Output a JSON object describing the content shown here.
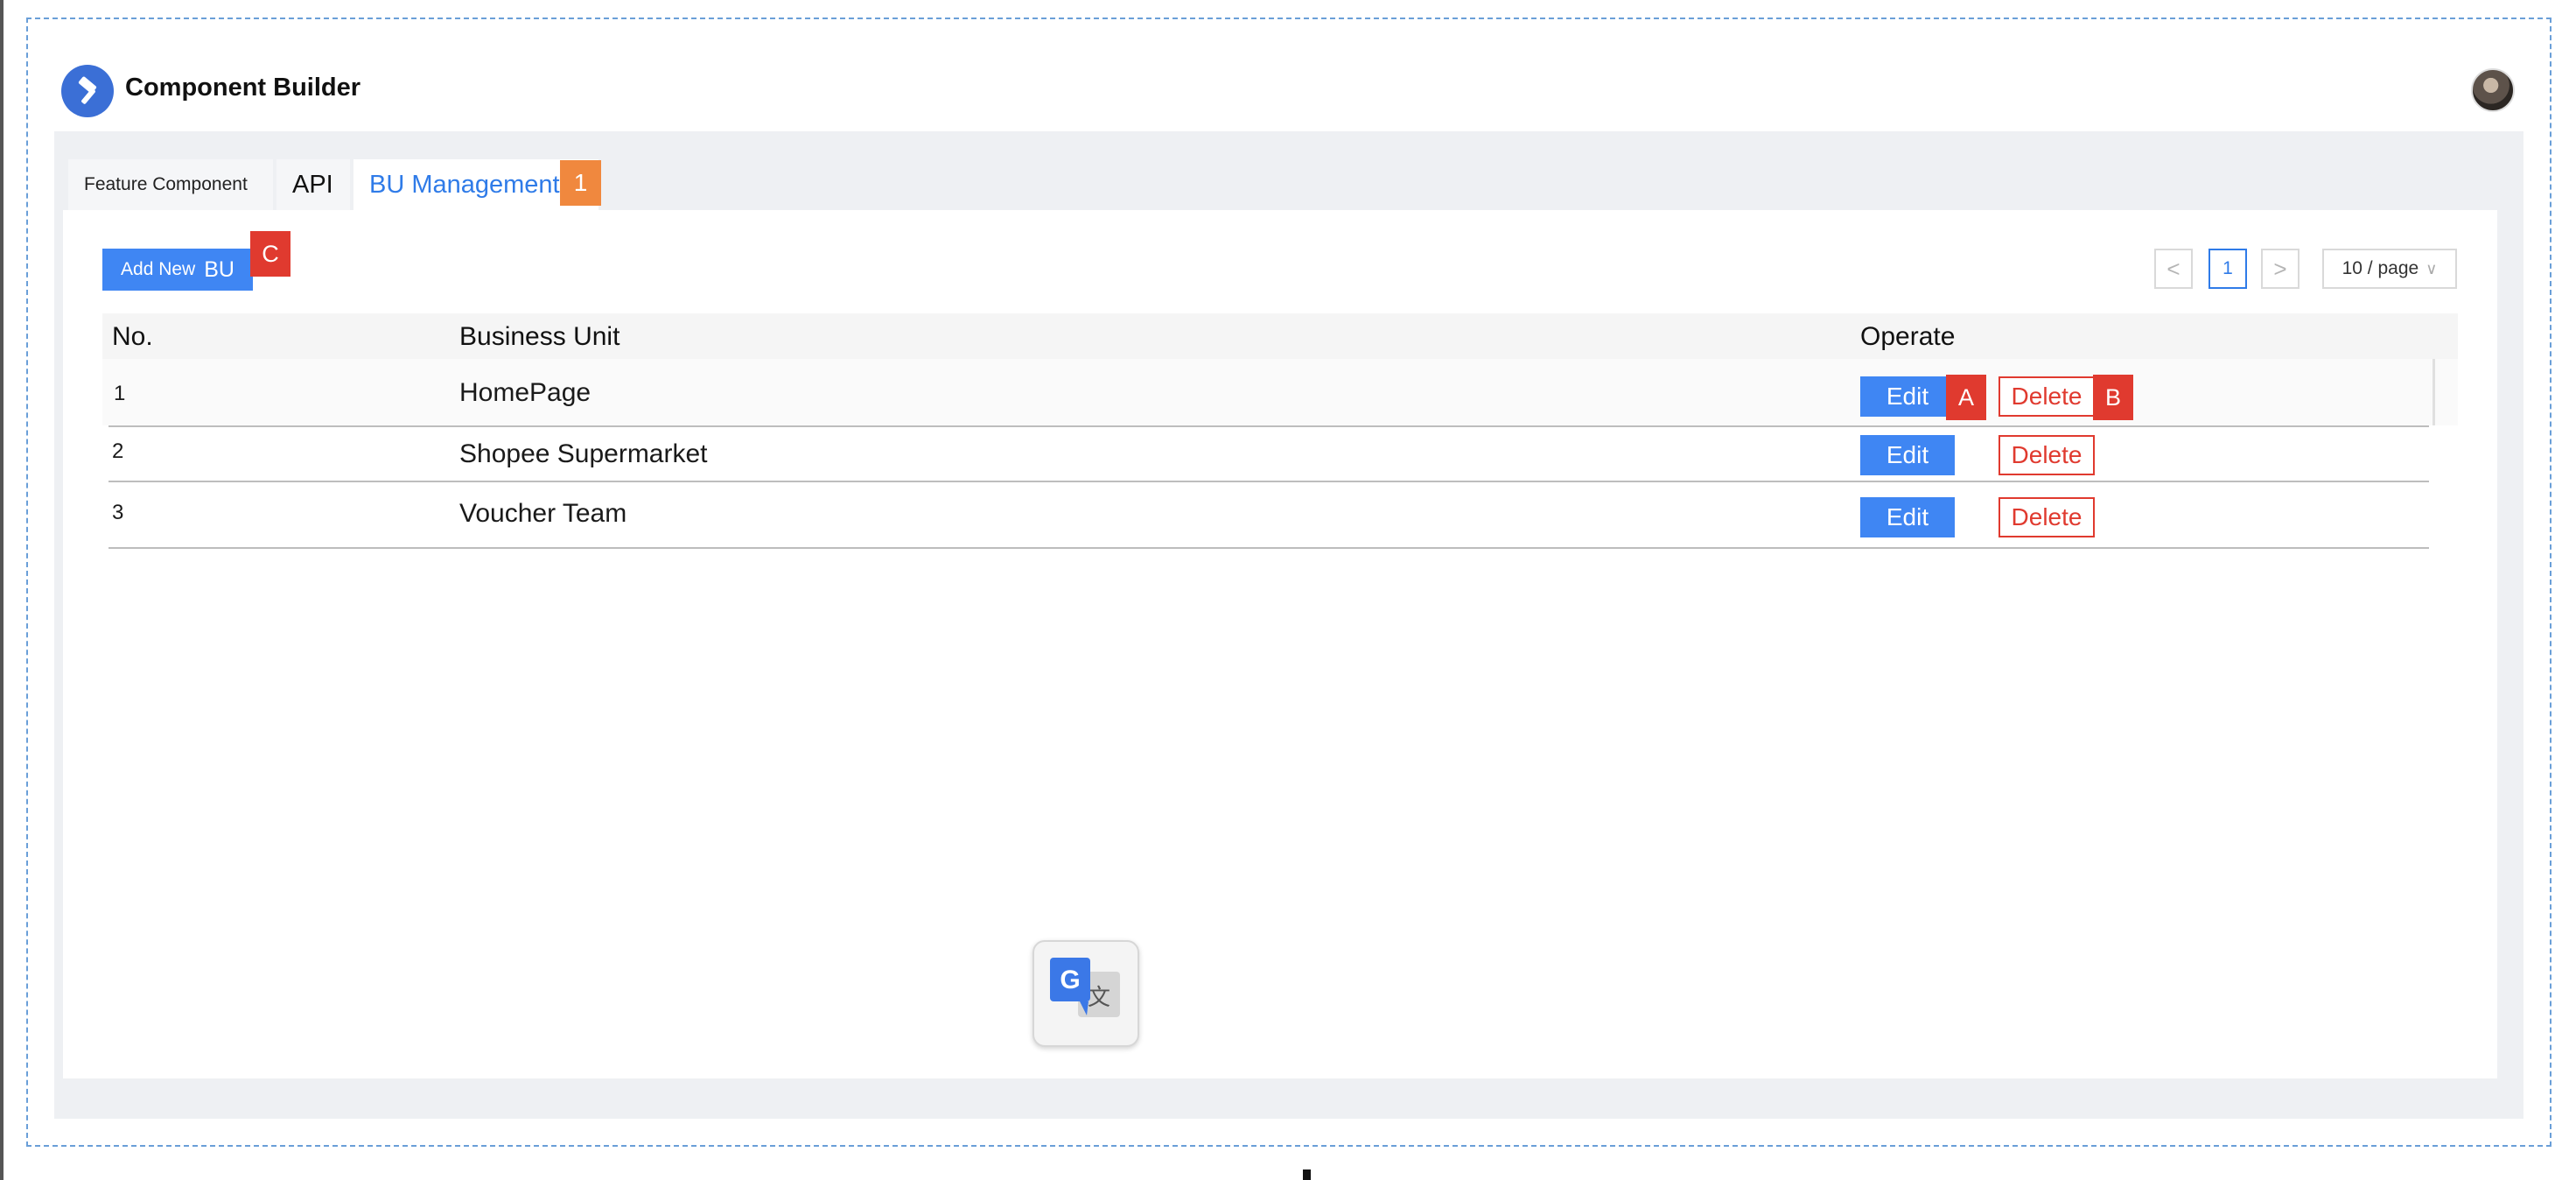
{
  "app": {
    "title": "Component Builder",
    "logo_icon": "hammer-icon",
    "avatar_icon": "user-avatar"
  },
  "tabs": [
    {
      "label": "Feature Component",
      "active": false
    },
    {
      "label": "API",
      "active": false
    },
    {
      "label": "BU Management",
      "active": true
    }
  ],
  "annotations": {
    "tab": "1",
    "add_button": "C",
    "edit": "A",
    "delete": "B"
  },
  "toolbar": {
    "add_label": "Add New",
    "add_suffix": "BU"
  },
  "pagination": {
    "prev": "<",
    "current": "1",
    "next": ">",
    "page_size": "10 / page"
  },
  "table": {
    "headers": {
      "no": "No.",
      "unit": "Business Unit",
      "operate": "Operate"
    },
    "rows": [
      {
        "no": "1",
        "unit": "HomePage",
        "edit": "Edit",
        "delete": "Delete"
      },
      {
        "no": "2",
        "unit": "Shopee Supermarket",
        "edit": "Edit",
        "delete": "Delete"
      },
      {
        "no": "3",
        "unit": "Voucher Team",
        "edit": "Edit",
        "delete": "Delete"
      }
    ]
  },
  "colors": {
    "primary": "#3f86f3",
    "danger": "#e03a2f",
    "annotation_orange": "#f0883e",
    "active_tab_text": "#2f7be8"
  },
  "icons": {
    "translate": "google-translate-icon",
    "chevron": "chevron-down-icon"
  }
}
